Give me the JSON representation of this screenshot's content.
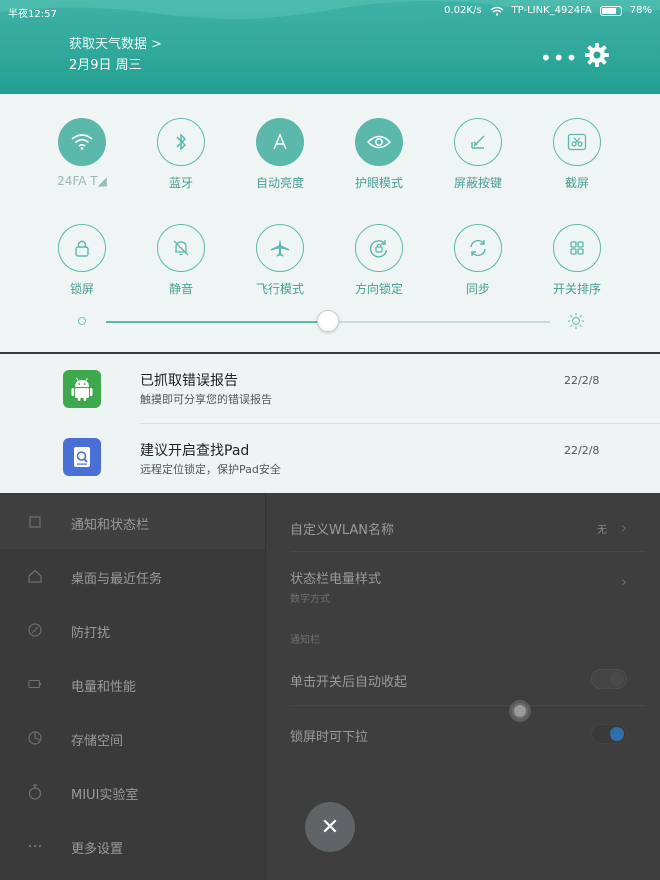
{
  "status_bar": {
    "time": "半夜12:57",
    "network_speed": "0.02K/s",
    "wifi_name": "TP-LINK_4924FA",
    "battery_percent": "78%",
    "battery_level": 0.78
  },
  "header": {
    "weather": "获取天气数据 >",
    "date": "2月9日 周三",
    "more": "•••"
  },
  "quick_settings": {
    "row1": [
      {
        "label": "24FA    T◢",
        "icon": "wifi-icon",
        "on": true
      },
      {
        "label": "蓝牙",
        "icon": "bluetooth-icon",
        "on": false
      },
      {
        "label": "自动亮度",
        "icon": "auto-brightness-icon",
        "on": true
      },
      {
        "label": "护眼模式",
        "icon": "eye-icon",
        "on": true
      },
      {
        "label": "屏蔽按键",
        "icon": "block-keys-icon",
        "on": false
      },
      {
        "label": "截屏",
        "icon": "screenshot-icon",
        "on": false
      }
    ],
    "row2": [
      {
        "label": "锁屏",
        "icon": "lock-icon",
        "on": false
      },
      {
        "label": "静音",
        "icon": "mute-bell-icon",
        "on": false
      },
      {
        "label": "飞行模式",
        "icon": "airplane-icon",
        "on": false
      },
      {
        "label": "方向锁定",
        "icon": "rotation-lock-icon",
        "on": false
      },
      {
        "label": "同步",
        "icon": "sync-icon",
        "on": false
      },
      {
        "label": "开关排序",
        "icon": "grid-icon",
        "on": false
      }
    ],
    "brightness": 0.5
  },
  "notifications": [
    {
      "title": "已抓取错误报告",
      "sub": "触摸即可分享您的错误报告",
      "time": "22/2/8",
      "icon": "android-icon",
      "color": "#3ea94c"
    },
    {
      "title": "建议开启查找Pad",
      "sub": "远程定位锁定，保护Pad安全",
      "time": "22/2/8",
      "icon": "find-device-icon",
      "color": "#4a6fd6"
    }
  ],
  "sidebar": [
    {
      "label": "通知和状态栏",
      "icon": "notification-icon"
    },
    {
      "label": "桌面与最近任务",
      "icon": "home-icon"
    },
    {
      "label": "防打扰",
      "icon": "dnd-icon"
    },
    {
      "label": "电量和性能",
      "icon": "battery-icon"
    },
    {
      "label": "存储空间",
      "icon": "storage-icon"
    },
    {
      "label": "MIUI实验室",
      "icon": "lab-icon"
    },
    {
      "label": "更多设置",
      "icon": "more-icon"
    }
  ],
  "settings": {
    "wlan_name_label": "自定义WLAN名称",
    "wlan_name_value": "无",
    "battery_style_label": "状态栏电量样式",
    "battery_style_sub": "数字方式",
    "section_title": "通知栏",
    "auto_collapse_label": "单击开关后自动收起",
    "lockscreen_pull_label": "锁屏时可下拉"
  },
  "close_button": "✕"
}
